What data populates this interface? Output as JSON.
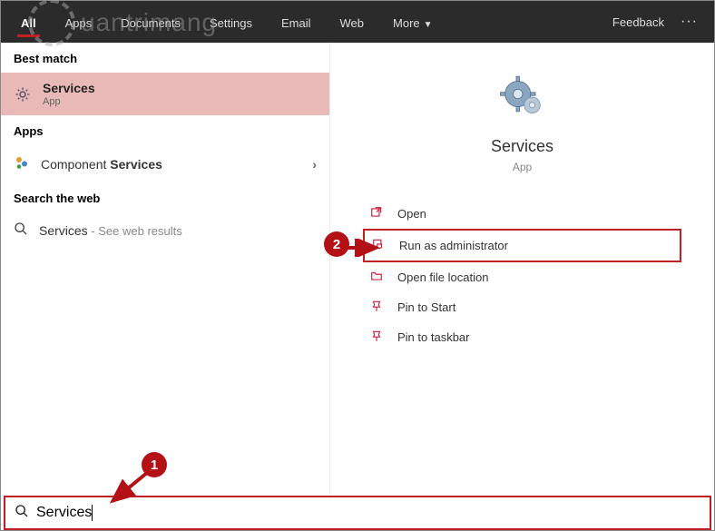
{
  "watermark": "uantrimang",
  "top": {
    "tabs": [
      {
        "label": "All",
        "active": true
      },
      {
        "label": "Apps",
        "active": false
      },
      {
        "label": "Documents",
        "active": false
      },
      {
        "label": "Settings",
        "active": false
      },
      {
        "label": "Email",
        "active": false
      },
      {
        "label": "Web",
        "active": false
      },
      {
        "label": "More",
        "active": false,
        "dropdown": true
      }
    ],
    "feedback": "Feedback"
  },
  "left": {
    "best_match_header": "Best match",
    "best_match": {
      "title": "Services",
      "sub": "App"
    },
    "apps_header": "Apps",
    "app_item_prefix": "Component ",
    "app_item_bold": "Services",
    "web_header": "Search the web",
    "web_item_prefix": "Services",
    "web_item_suffix": " - See web results"
  },
  "right": {
    "title": "Services",
    "sub": "App",
    "actions": [
      {
        "label": "Open",
        "icon": "open"
      },
      {
        "label": "Run as administrator",
        "icon": "admin",
        "hl": true
      },
      {
        "label": "Open file location",
        "icon": "folder"
      },
      {
        "label": "Pin to Start",
        "icon": "pin"
      },
      {
        "label": "Pin to taskbar",
        "icon": "pin"
      }
    ]
  },
  "search": {
    "value": "Services"
  },
  "callouts": {
    "one": "1",
    "two": "2"
  }
}
